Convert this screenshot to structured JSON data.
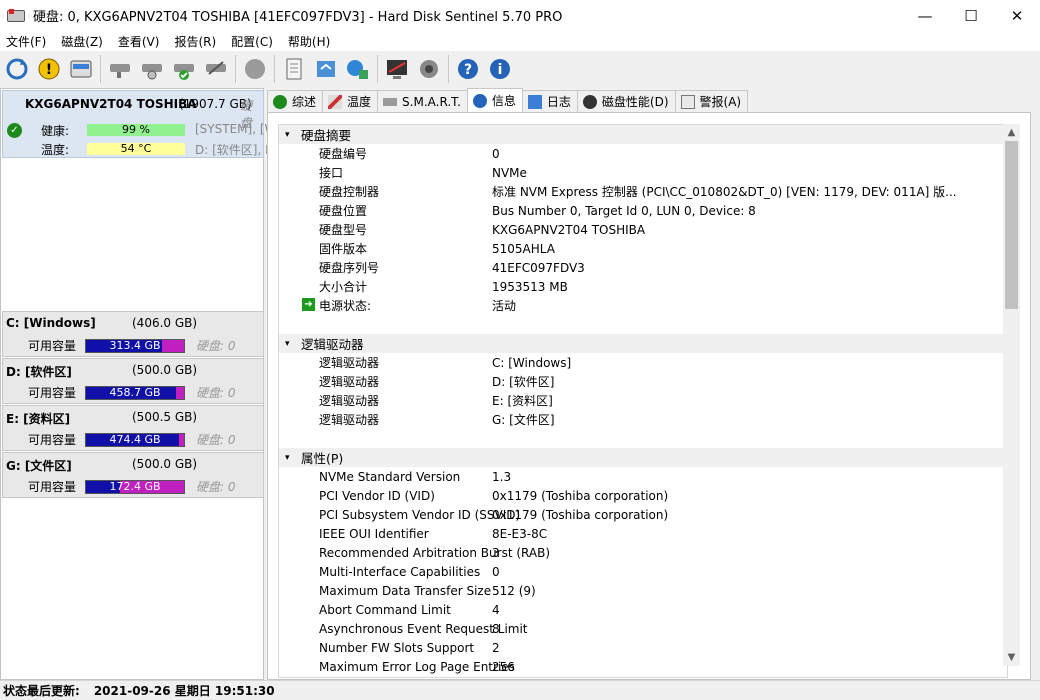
{
  "window": {
    "title": "硬盘:  0, KXG6APNV2T04 TOSHIBA [41EFC097FDV3]  -  Hard Disk Sentinel 5.70 PRO",
    "minimize": "—",
    "maximize": "☐",
    "close": "✕"
  },
  "menu": [
    "文件(F)",
    "磁盘(Z)",
    "查看(V)",
    "报告(R)",
    "配置(C)",
    "帮助(H)"
  ],
  "toolbar": {
    "icons": [
      "refresh-icon",
      "alert-icon",
      "disk-info-icon",
      "hdd-test-icon",
      "hdd-surface-icon",
      "hdd-ok-icon",
      "hdd-remove-icon",
      "stop-icon",
      "report-icon",
      "sync-icon",
      "network-icon",
      "monitor-icon",
      "speaker-icon",
      "help-icon",
      "info-icon"
    ]
  },
  "disk": {
    "name": "KXG6APNV2T04 TOSHIBA",
    "size": "(1907.7 GB)",
    "hint": "硬盘",
    "health_label": "健康:",
    "health_value": "99 %",
    "health_percent": 99,
    "temp_label": "温度:",
    "temp_value": "54 °C",
    "partitions_line1": "[SYSTEM], [W",
    "partitions_line2": "D: [软件区], E"
  },
  "volumes": [
    {
      "name": "C: [Windows]",
      "size": "(406.0 GB)",
      "free_label": "可用容量",
      "free": "313.4 GB",
      "free_fraction": 0.772,
      "disk": "硬盘: 0"
    },
    {
      "name": "D: [软件区]",
      "size": "(500.0 GB)",
      "free_label": "可用容量",
      "free": "458.7 GB",
      "free_fraction": 0.917,
      "disk": "硬盘: 0"
    },
    {
      "name": "E: [资料区]",
      "size": "(500.5 GB)",
      "free_label": "可用容量",
      "free": "474.4 GB",
      "free_fraction": 0.948,
      "disk": "硬盘: 0"
    },
    {
      "name": "G: [文件区]",
      "size": "(500.0 GB)",
      "free_label": "可用容量",
      "free": "172.4 GB",
      "free_fraction": 0.345,
      "disk": "硬盘: 0"
    }
  ],
  "tabs": [
    "综述",
    "温度",
    "S.M.A.R.T.",
    "信息",
    "日志",
    "磁盘性能(D)",
    "警报(A)"
  ],
  "active_tab": "信息",
  "sections": {
    "summary": {
      "title": "硬盘摘要",
      "rows": [
        {
          "k": "硬盘编号",
          "v": "0"
        },
        {
          "k": "接口",
          "v": "NVMe"
        },
        {
          "k": "硬盘控制器",
          "v": "标准 NVM Express 控制器 (PCI\\CC_010802&DT_0) [VEN: 1179, DEV: 011A] 版..."
        },
        {
          "k": "硬盘位置",
          "v": "Bus Number 0, Target Id 0, LUN 0, Device: 8"
        },
        {
          "k": "硬盘型号",
          "v": "KXG6APNV2T04 TOSHIBA"
        },
        {
          "k": "固件版本",
          "v": "5105AHLA"
        },
        {
          "k": "硬盘序列号",
          "v": "41EFC097FDV3"
        },
        {
          "k": "大小合计",
          "v": "1953513 MB"
        },
        {
          "k": "电源状态:",
          "v": "活动"
        }
      ]
    },
    "logical": {
      "title": "逻辑驱动器",
      "rows": [
        {
          "k": "逻辑驱动器",
          "v": "C: [Windows]"
        },
        {
          "k": "逻辑驱动器",
          "v": "D: [软件区]"
        },
        {
          "k": "逻辑驱动器",
          "v": "E: [资料区]"
        },
        {
          "k": "逻辑驱动器",
          "v": "G: [文件区]"
        }
      ]
    },
    "props": {
      "title": "属性(P)",
      "rows": [
        {
          "k": "NVMe Standard Version",
          "v": "1.3"
        },
        {
          "k": "PCI Vendor ID (VID)",
          "v": "0x1179 (Toshiba corporation)"
        },
        {
          "k": "PCI Subsystem Vendor ID (SSVID)",
          "v": "0x1179 (Toshiba corporation)"
        },
        {
          "k": "IEEE OUI Identifier",
          "v": "8E-E3-8C"
        },
        {
          "k": "Recommended Arbitration Burst (RAB)",
          "v": "3"
        },
        {
          "k": "Multi-Interface Capabilities",
          "v": "0"
        },
        {
          "k": "Maximum Data Transfer Size",
          "v": "512 (9)"
        },
        {
          "k": "Abort Command Limit",
          "v": "4"
        },
        {
          "k": "Asynchronous Event Request Limit",
          "v": "8"
        },
        {
          "k": "Number FW Slots Support",
          "v": "2"
        },
        {
          "k": "Maximum Error Log Page Entries",
          "v": "256"
        }
      ]
    }
  },
  "status": {
    "label": "状态最后更新:",
    "value": "2021-09-26 星期日 19:51:30"
  },
  "colors": {
    "health_bar": "#8ff28f",
    "temp_bar": "#ffff99",
    "volume_free": "#1010a8",
    "volume_used": "#c020c0",
    "disk_card_bg": "#dbe6f2"
  }
}
